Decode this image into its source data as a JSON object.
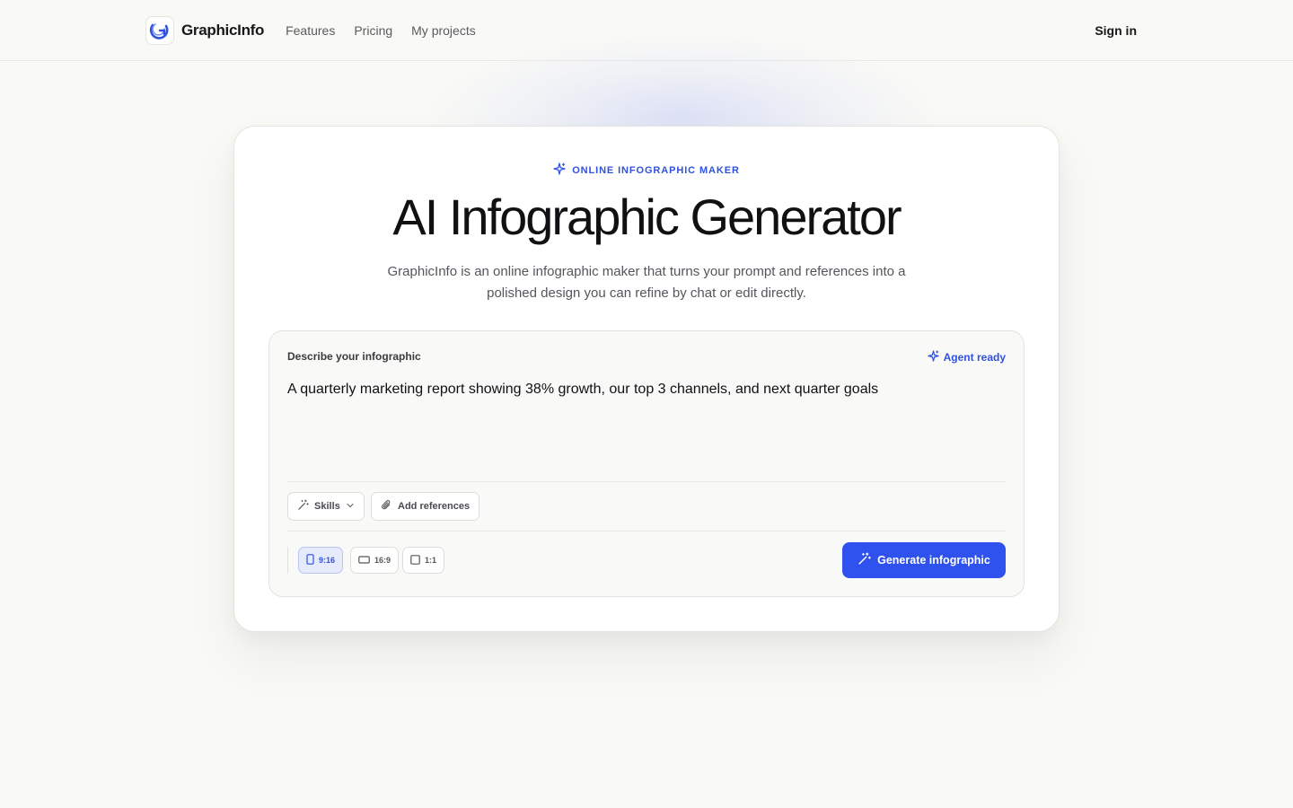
{
  "nav": {
    "brand": "GraphicInfo",
    "links": [
      "Features",
      "Pricing",
      "My projects"
    ],
    "signin": "Sign in"
  },
  "hero": {
    "eyebrow": "ONLINE INFOGRAPHIC MAKER",
    "title": "AI Infographic Generator",
    "subtitle": "GraphicInfo is an online infographic maker that turns your prompt and references into a polished design you can refine by chat or edit directly."
  },
  "composer": {
    "label": "Describe your infographic",
    "agent_status": "Agent ready",
    "prompt_value": "A quarterly marketing report showing 38% growth, our top 3 channels, and next quarter goals",
    "skills_label": "Skills",
    "references_label": "Add references",
    "ratios": [
      {
        "label": "9:16",
        "icon": "portrait-icon",
        "selected": true
      },
      {
        "label": "16:9",
        "icon": "landscape-icon",
        "selected": false
      },
      {
        "label": "1:1",
        "icon": "square-icon",
        "selected": false
      }
    ],
    "generate_label": "Generate infographic"
  },
  "colors": {
    "accent": "#2f52ee",
    "background": "#f9f9f6",
    "card": "#ffffff"
  }
}
